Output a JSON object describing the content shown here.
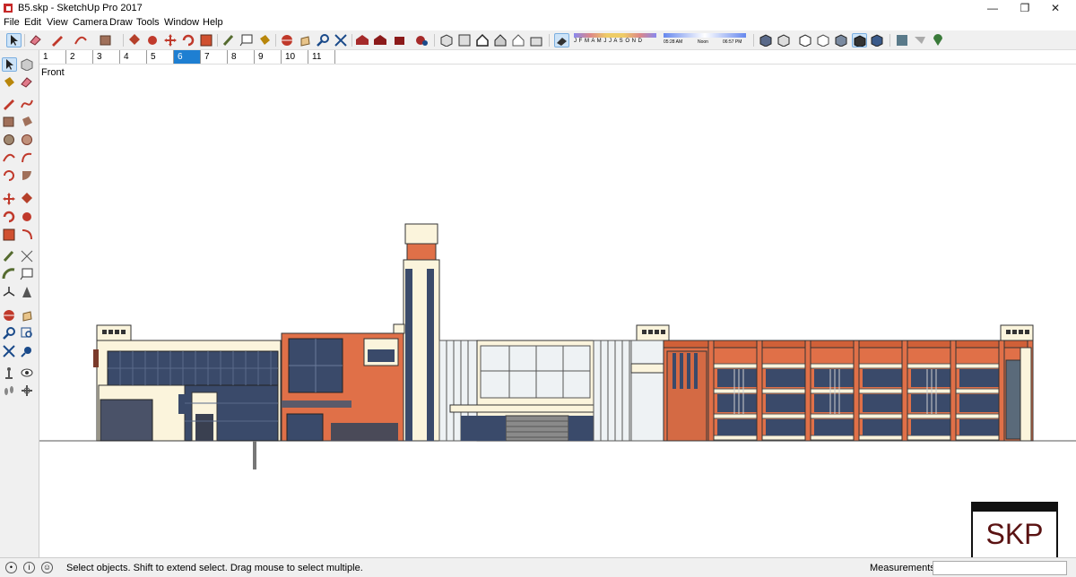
{
  "window": {
    "title": "B5.skp - SketchUp Pro 2017",
    "minimize": "—",
    "maximize": "❐",
    "close": "✕"
  },
  "menu": [
    "File",
    "Edit",
    "View",
    "Camera",
    "Draw",
    "Tools",
    "Window",
    "Help"
  ],
  "shadow_panel": {
    "months": "J F M A M J J A S O N D",
    "time_start": "05:28 AM",
    "time_mid": "Noon",
    "time_end": "06:57 PM"
  },
  "scenes": {
    "tabs": [
      "1",
      "2",
      "3",
      "4",
      "5",
      "6",
      "7",
      "8",
      "9",
      "10",
      "11"
    ],
    "active": "6"
  },
  "viewport": {
    "scene_label": "Front"
  },
  "status": {
    "text": "Select objects. Shift to extend select. Drag mouse to select multiple.",
    "measurements_label": "Measurements"
  },
  "badge": {
    "text": "SKP"
  }
}
